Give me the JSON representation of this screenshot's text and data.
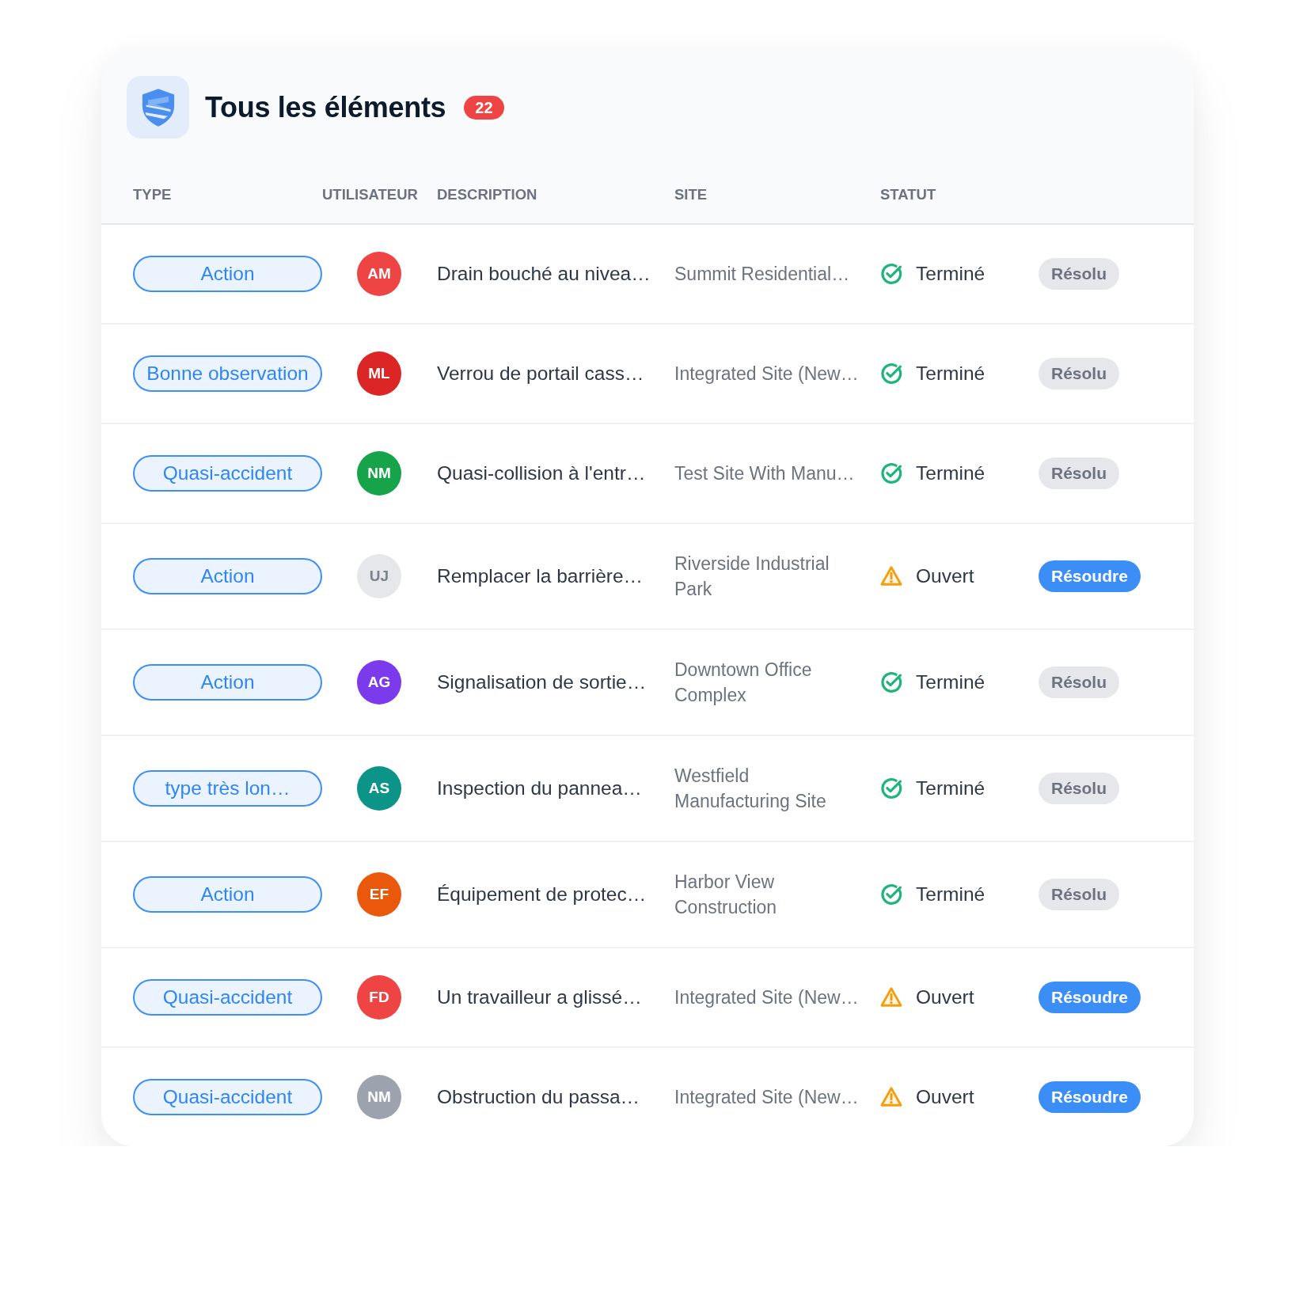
{
  "header": {
    "title": "Tous les éléments",
    "count": "22"
  },
  "table": {
    "columns": [
      "TYPE",
      "UTILISATEUR",
      "DESCRIPTION",
      "SITE",
      "STATUT"
    ],
    "rows": [
      {
        "type": "Action",
        "user": {
          "initials": "AM",
          "color": "#ef4444"
        },
        "description": "Drain bouché au nivea…",
        "site": "Summit Residential…",
        "status": {
          "kind": "done",
          "label": "Terminé"
        },
        "action": {
          "kind": "resolved",
          "label": "Résolu"
        }
      },
      {
        "type": "Bonne observation",
        "user": {
          "initials": "ML",
          "color": "#dc2626"
        },
        "description": "Verrou de portail cass…",
        "site": "Integrated Site (New…",
        "status": {
          "kind": "done",
          "label": "Terminé"
        },
        "action": {
          "kind": "resolved",
          "label": "Résolu"
        }
      },
      {
        "type": "Quasi-accident",
        "user": {
          "initials": "NM",
          "color": "#16a34a"
        },
        "description": "Quasi-collision à l'entr…",
        "site": "Test Site With Manu…",
        "status": {
          "kind": "done",
          "label": "Terminé"
        },
        "action": {
          "kind": "resolved",
          "label": "Résolu"
        }
      },
      {
        "type": "Action",
        "user": {
          "initials": "UJ",
          "color": "#e5e7eb"
        },
        "description": "Remplacer la barrière…",
        "site": "Riverside Industrial Park",
        "status": {
          "kind": "open",
          "label": "Ouvert"
        },
        "action": {
          "kind": "resolve",
          "label": "Résoudre"
        }
      },
      {
        "type": "Action",
        "user": {
          "initials": "AG",
          "color": "#7c3aed"
        },
        "description": "Signalisation de sortie…",
        "site": "Downtown Office Complex",
        "status": {
          "kind": "done",
          "label": "Terminé"
        },
        "action": {
          "kind": "resolved",
          "label": "Résolu"
        }
      },
      {
        "type": "type très lon…",
        "user": {
          "initials": "AS",
          "color": "#0d9488"
        },
        "description": "Inspection du pannea…",
        "site": "Westfield Manufacturing Site",
        "status": {
          "kind": "done",
          "label": "Terminé"
        },
        "action": {
          "kind": "resolved",
          "label": "Résolu"
        }
      },
      {
        "type": "Action",
        "user": {
          "initials": "EF",
          "color": "#ea580c"
        },
        "description": "Équipement de protec…",
        "site": "Harbor View Construction",
        "status": {
          "kind": "done",
          "label": "Terminé"
        },
        "action": {
          "kind": "resolved",
          "label": "Résolu"
        }
      },
      {
        "type": "Quasi-accident",
        "user": {
          "initials": "FD",
          "color": "#ef4444"
        },
        "description": "Un travailleur a glissé…",
        "site": "Integrated Site (New…",
        "status": {
          "kind": "open",
          "label": "Ouvert"
        },
        "action": {
          "kind": "resolve",
          "label": "Résoudre"
        }
      },
      {
        "type": "Quasi-accident",
        "user": {
          "initials": "NM",
          "color": "#9ca3af"
        },
        "description": "Obstruction du passa…",
        "site": "Integrated Site (New…",
        "status": {
          "kind": "open",
          "label": "Ouvert"
        },
        "action": {
          "kind": "resolve",
          "label": "Résoudre"
        }
      }
    ]
  }
}
